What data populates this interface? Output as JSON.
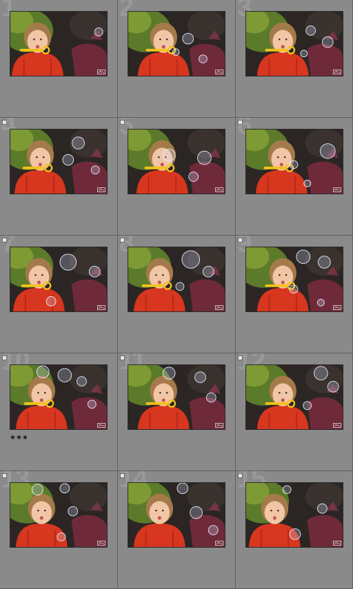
{
  "grid": {
    "cells": [
      {
        "number": "1",
        "rating": "",
        "flag": false
      },
      {
        "number": "2",
        "rating": "",
        "flag": false
      },
      {
        "number": "3",
        "rating": "",
        "flag": false
      },
      {
        "number": "4",
        "rating": "",
        "flag": true
      },
      {
        "number": "5",
        "rating": "",
        "flag": true
      },
      {
        "number": "6",
        "rating": "",
        "flag": true
      },
      {
        "number": "7",
        "rating": "",
        "flag": true
      },
      {
        "number": "8",
        "rating": "",
        "flag": true
      },
      {
        "number": "9",
        "rating": "",
        "flag": true
      },
      {
        "number": "10",
        "rating": "★★★",
        "flag": true
      },
      {
        "number": "11",
        "rating": "",
        "flag": true
      },
      {
        "number": "12",
        "rating": "",
        "flag": true
      },
      {
        "number": "13",
        "rating": "",
        "flag": true
      },
      {
        "number": "14",
        "rating": "",
        "flag": true
      },
      {
        "number": "15",
        "rating": "",
        "flag": true
      }
    ]
  },
  "icons": {
    "thumbnail_badge": "edited-badge-icon",
    "cell_flag": "pick-flag-icon"
  }
}
